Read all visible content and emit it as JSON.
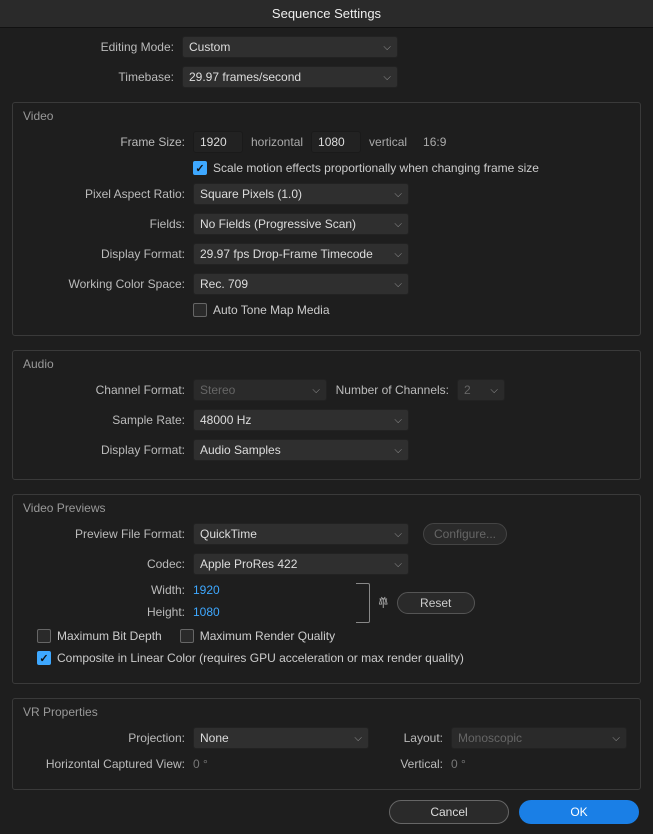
{
  "title": "Sequence Settings",
  "editingMode": {
    "label": "Editing Mode:",
    "value": "Custom"
  },
  "timebase": {
    "label": "Timebase:",
    "value": "29.97  frames/second"
  },
  "video": {
    "legend": "Video",
    "frameSize": {
      "label": "Frame Size:",
      "w": "1920",
      "h": "1080",
      "horiz": "horizontal",
      "vert": "vertical",
      "aspect": "16:9"
    },
    "scaleMotion": {
      "label": "Scale motion effects proportionally when changing frame size",
      "checked": true
    },
    "pixelAspect": {
      "label": "Pixel Aspect Ratio:",
      "value": "Square Pixels (1.0)"
    },
    "fields": {
      "label": "Fields:",
      "value": "No Fields (Progressive Scan)"
    },
    "displayFormat": {
      "label": "Display Format:",
      "value": "29.97 fps Drop-Frame Timecode"
    },
    "colorSpace": {
      "label": "Working Color Space:",
      "value": "Rec. 709"
    },
    "autoToneMap": {
      "label": "Auto Tone Map Media",
      "checked": false
    }
  },
  "audio": {
    "legend": "Audio",
    "channelFormat": {
      "label": "Channel Format:",
      "value": "Stereo"
    },
    "numChannels": {
      "label": "Number of Channels:",
      "value": "2"
    },
    "sampleRate": {
      "label": "Sample Rate:",
      "value": "48000 Hz"
    },
    "displayFormat": {
      "label": "Display Format:",
      "value": "Audio Samples"
    }
  },
  "previews": {
    "legend": "Video Previews",
    "fileFormat": {
      "label": "Preview File Format:",
      "value": "QuickTime"
    },
    "configure": "Configure...",
    "codec": {
      "label": "Codec:",
      "value": "Apple ProRes 422"
    },
    "width": {
      "label": "Width:",
      "value": "1920"
    },
    "height": {
      "label": "Height:",
      "value": "1080"
    },
    "reset": "Reset",
    "maxBitDepth": {
      "label": "Maximum Bit Depth",
      "checked": false
    },
    "maxRenderQuality": {
      "label": "Maximum Render Quality",
      "checked": false
    },
    "composite": {
      "label": "Composite in Linear Color (requires GPU acceleration or max render quality)",
      "checked": true
    }
  },
  "vr": {
    "legend": "VR Properties",
    "projection": {
      "label": "Projection:",
      "value": "None"
    },
    "layout": {
      "label": "Layout:",
      "value": "Monoscopic"
    },
    "horiz": {
      "label": "Horizontal Captured View:",
      "value": "0 °"
    },
    "vert": {
      "label": "Vertical:",
      "value": "0 °"
    }
  },
  "buttons": {
    "cancel": "Cancel",
    "ok": "OK"
  }
}
